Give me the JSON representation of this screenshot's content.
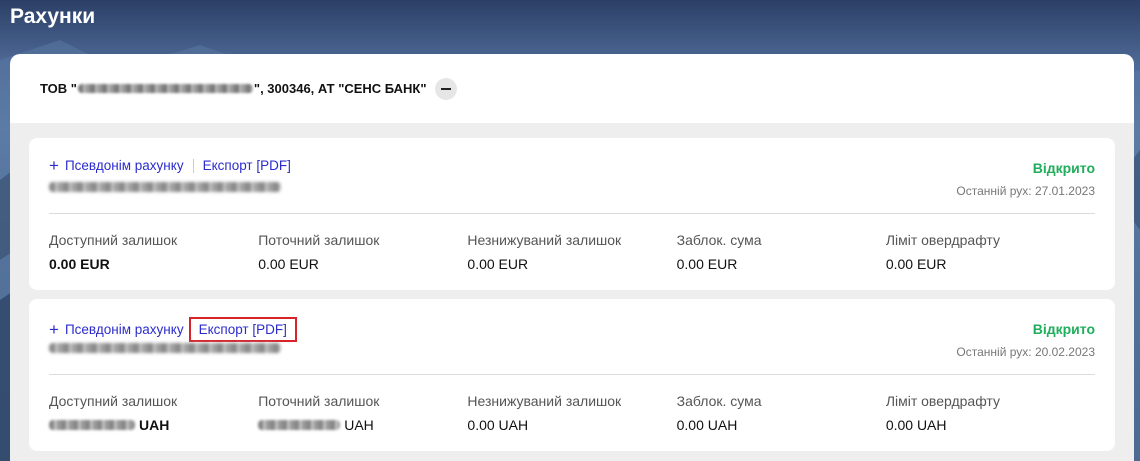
{
  "page": {
    "title": "Рахунки"
  },
  "company": {
    "prefix": "ТОВ \"",
    "name_redacted": true,
    "suffix": "\", 300346, АТ \"СЕНС БАНК\""
  },
  "accounts": [
    {
      "alias_label": "Псевдонім рахунку",
      "export_label": "Експорт [PDF]",
      "status": "Відкрито",
      "last_movement": "Останній рух: 27.01.2023",
      "metrics": [
        {
          "label": "Доступний залишок",
          "value": "0.00 EUR"
        },
        {
          "label": "Поточний залишок",
          "value": "0.00 EUR"
        },
        {
          "label": "Незнижуваний залишок",
          "value": "0.00 EUR"
        },
        {
          "label": "Заблок. сума",
          "value": "0.00 EUR"
        },
        {
          "label": "Ліміт овердрафту",
          "value": "0.00 EUR"
        }
      ]
    },
    {
      "alias_label": "Псевдонім рахунку",
      "export_label": "Експорт [PDF]",
      "status": "Відкрито",
      "last_movement": "Останній рух: 20.02.2023",
      "metrics": [
        {
          "label": "Доступний залишок",
          "value": "UAH"
        },
        {
          "label": "Поточний залишок",
          "value": "UAH"
        },
        {
          "label": "Незнижуваний залишок",
          "value": "0.00 UAH"
        },
        {
          "label": "Заблок. сума",
          "value": "0.00 UAH"
        },
        {
          "label": "Ліміт овердрафту",
          "value": "0.00 UAH"
        }
      ]
    }
  ],
  "colors": {
    "link": "#2c2ccc",
    "status_open": "#1fae5b",
    "highlight": "#d9232a"
  },
  "icons": {
    "add": "plus-icon",
    "collapse": "minus-icon"
  }
}
